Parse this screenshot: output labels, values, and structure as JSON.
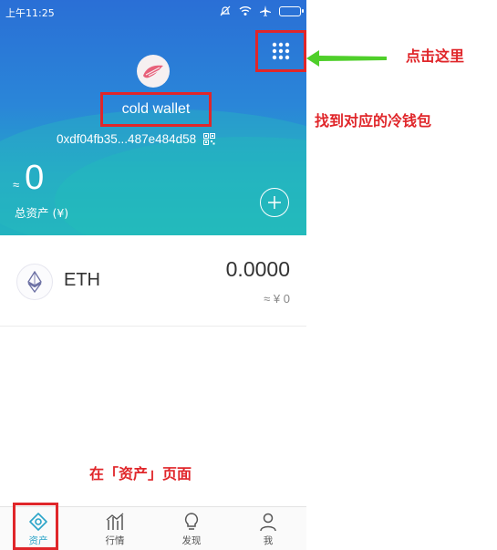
{
  "status_bar": {
    "time": "上午11:25",
    "icons": [
      "bell-off-icon",
      "wifi-icon",
      "airplane-icon",
      "battery-icon"
    ]
  },
  "wallet": {
    "name": "cold wallet",
    "address": "0xdf04fb35...487e484d58",
    "balance_approx": "≈",
    "balance": "0",
    "total_label": "总资产 (¥)"
  },
  "assets": [
    {
      "symbol": "ETH",
      "amount": "0.0000",
      "fiat": "≈ ¥ 0"
    }
  ],
  "nav": {
    "items": [
      {
        "label": "资产",
        "icon": "assets-icon",
        "active": true
      },
      {
        "label": "行情",
        "icon": "market-chart-icon",
        "active": false
      },
      {
        "label": "发现",
        "icon": "lightbulb-icon",
        "active": false
      },
      {
        "label": "我",
        "icon": "profile-icon",
        "active": false
      }
    ]
  },
  "annotations": {
    "click_here": "点击这里",
    "find_wallet": "找到对应的冷钱包",
    "on_page": "在「资产」页面"
  },
  "colors": {
    "header_gradient_top": "#2a6fd6",
    "header_gradient_bottom": "#22b3bf",
    "annotation_red": "#e0262a",
    "arrow_green": "#4fcf2a",
    "nav_active": "#2aa4c8"
  }
}
